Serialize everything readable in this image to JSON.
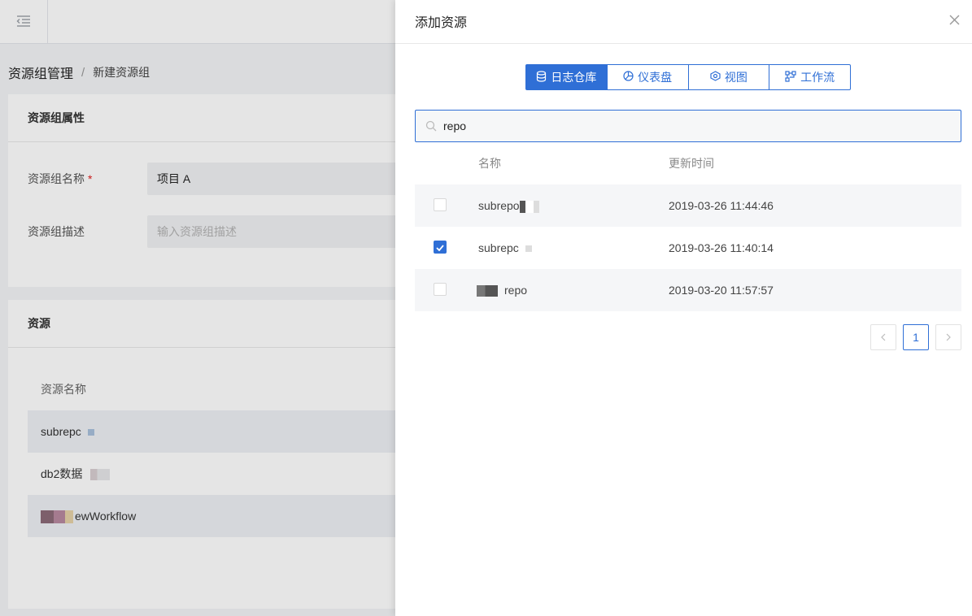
{
  "breadcrumb": {
    "parent": "资源组管理",
    "separator": "/",
    "current": "新建资源组"
  },
  "group_props": {
    "title": "资源组属性",
    "name_label": "资源组名称",
    "required_mark": "*",
    "name_value": "项目 A",
    "desc_label": "资源组描述",
    "desc_placeholder": "输入资源组描述"
  },
  "resources": {
    "title": "资源",
    "column_header": "资源名称",
    "items": [
      {
        "name": "subrepc"
      },
      {
        "name": "db2数据"
      },
      {
        "name": "ewWorkflow"
      }
    ]
  },
  "drawer": {
    "title": "添加资源",
    "tabs": [
      {
        "label": "日志仓库",
        "icon": "database-icon",
        "active": true
      },
      {
        "label": "仪表盘",
        "icon": "dashboard-icon",
        "active": false
      },
      {
        "label": "视图",
        "icon": "view-icon",
        "active": false
      },
      {
        "label": "工作流",
        "icon": "workflow-icon",
        "active": false
      }
    ],
    "search": {
      "value": "repo"
    },
    "table": {
      "headers": {
        "name": "名称",
        "time": "更新时间"
      },
      "rows": [
        {
          "name": "subrepo",
          "time": "2019-03-26 11:44:46",
          "checked": false
        },
        {
          "name": "subrepc",
          "time": "2019-03-26 11:40:14",
          "checked": true
        },
        {
          "name": "repo",
          "time": "2019-03-20 11:57:57",
          "checked": false
        }
      ]
    },
    "pagination": {
      "current_page": "1"
    }
  },
  "colors": {
    "primary": "#2f6fd6",
    "required": "#e02020"
  }
}
